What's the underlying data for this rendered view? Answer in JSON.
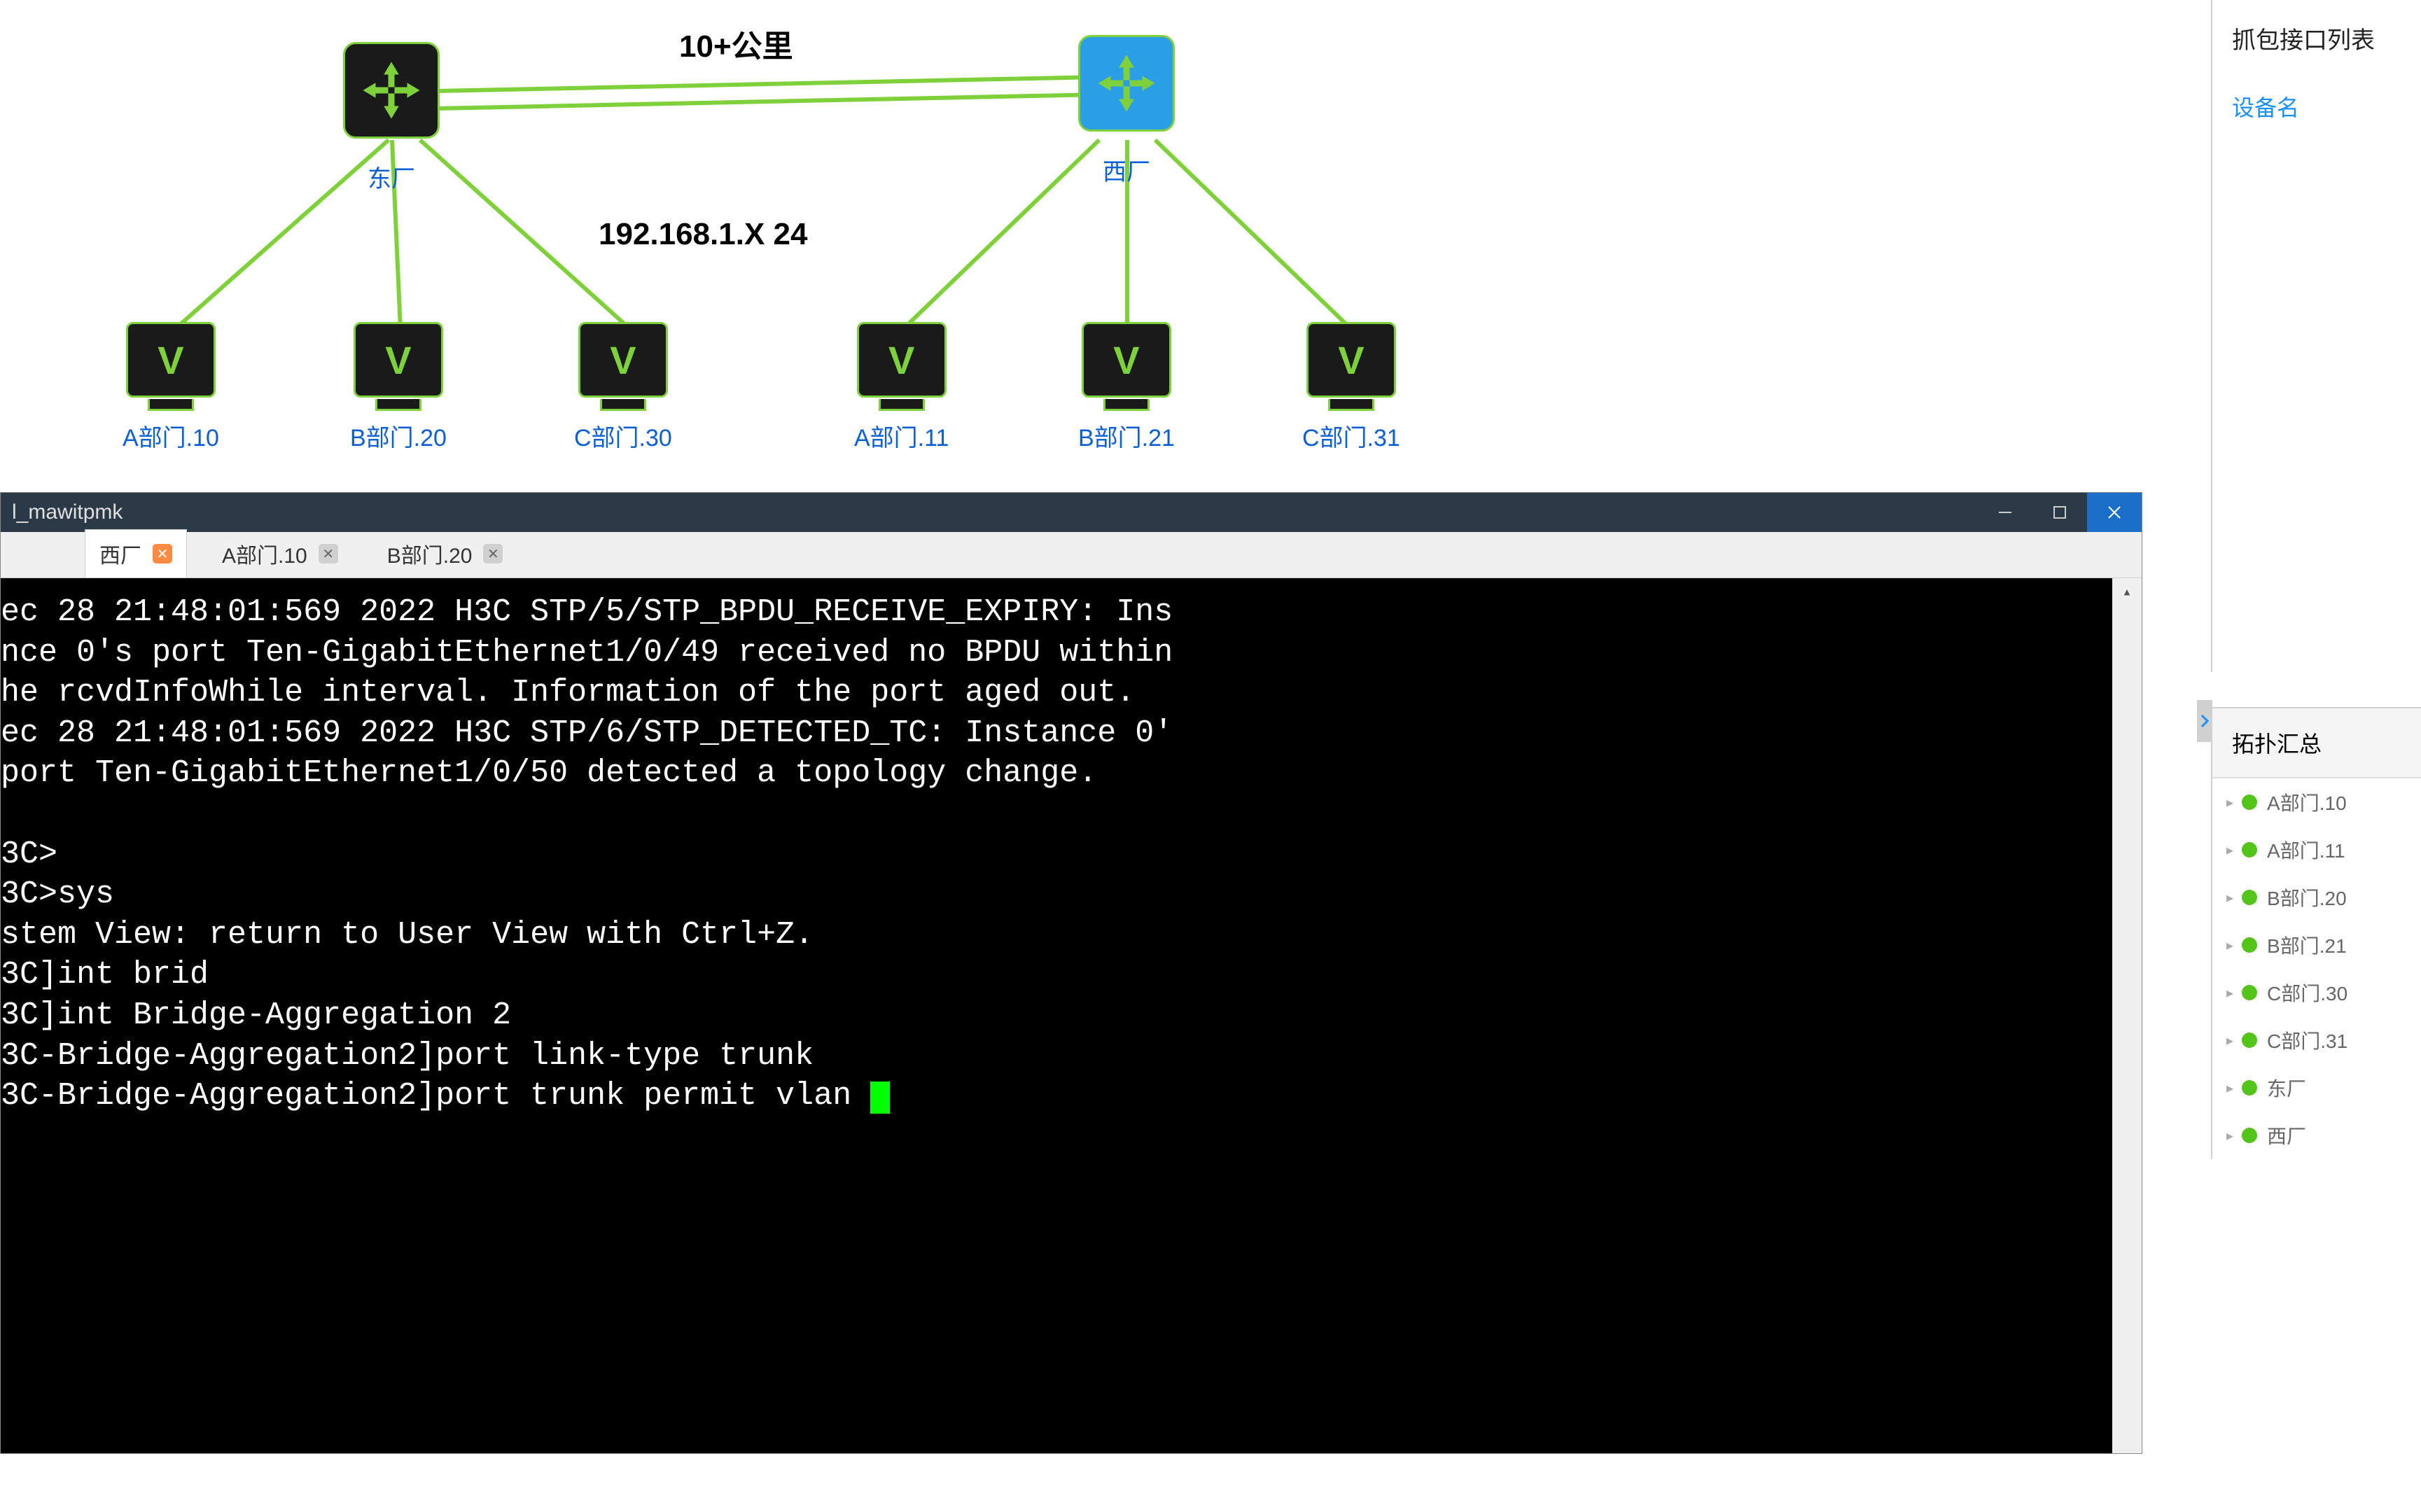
{
  "topology": {
    "annotations": {
      "distance": "10+公里",
      "subnet": "192.168.1.X  24"
    },
    "switches": [
      {
        "id": "east",
        "label": "东厂"
      },
      {
        "id": "west",
        "label": "西厂"
      }
    ],
    "pcs": [
      {
        "label": "A部门.10"
      },
      {
        "label": "B部门.20"
      },
      {
        "label": "C部门.30"
      },
      {
        "label": "A部门.11"
      },
      {
        "label": "B部门.21"
      },
      {
        "label": "C部门.31"
      }
    ]
  },
  "right_panel": {
    "capture_title": "抓包接口列表",
    "device_link": "设备名"
  },
  "topo_summary": {
    "title": "拓扑汇总",
    "items": [
      "A部门.10",
      "A部门.11",
      "B部门.20",
      "B部门.21",
      "C部门.30",
      "C部门.31",
      "东厂",
      "西厂"
    ]
  },
  "terminal": {
    "window_title": "l_mawitpmk",
    "tabs": [
      {
        "label": "西厂",
        "active": true,
        "orange_close": true
      },
      {
        "label": "A部门.10",
        "active": false,
        "orange_close": false
      },
      {
        "label": "B部门.20",
        "active": false,
        "orange_close": false
      }
    ],
    "lines": [
      "ec 28 21:48:01:569 2022 H3C STP/5/STP_BPDU_RECEIVE_EXPIRY: Ins",
      "nce 0's port Ten-GigabitEthernet1/0/49 received no BPDU within",
      "he rcvdInfoWhile interval. Information of the port aged out.",
      "ec 28 21:48:01:569 2022 H3C STP/6/STP_DETECTED_TC: Instance 0'",
      "port Ten-GigabitEthernet1/0/50 detected a topology change.",
      "",
      "3C>",
      "3C>sys",
      "stem View: return to User View with Ctrl+Z.",
      "3C]int brid",
      "3C]int Bridge-Aggregation 2",
      "3C-Bridge-Aggregation2]port link-type trunk",
      "3C-Bridge-Aggregation2]port trunk permit vlan "
    ]
  }
}
